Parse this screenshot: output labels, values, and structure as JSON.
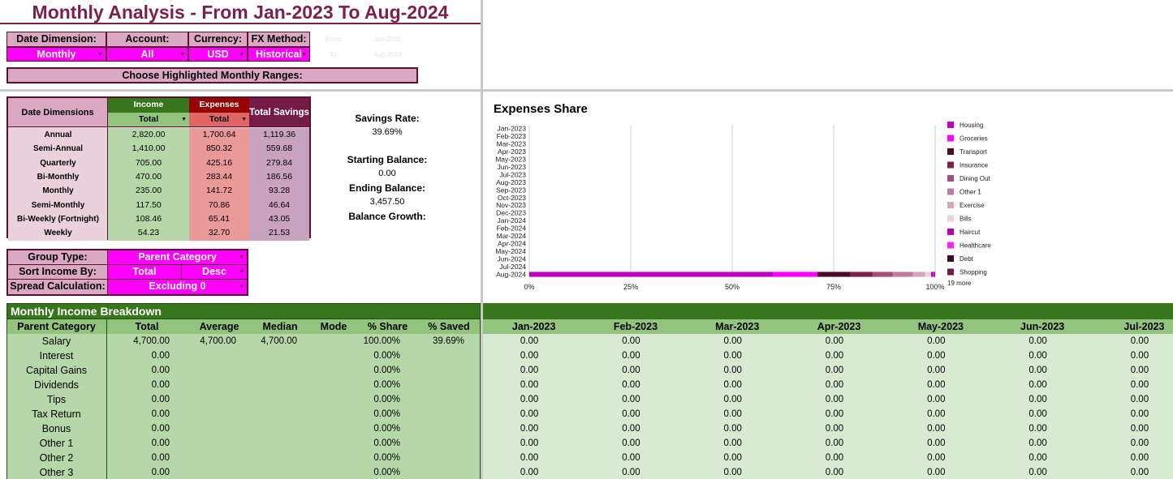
{
  "title": "Monthly Analysis - From Jan-2023 To Aug-2024",
  "controls": {
    "date_dimension": {
      "label": "Date Dimension:",
      "value": "Monthly"
    },
    "account": {
      "label": "Account:",
      "value": "All"
    },
    "currency": {
      "label": "Currency:",
      "value": "USD"
    },
    "fx_method": {
      "label": "FX Method:",
      "value": "Historical"
    },
    "from_label": "From:",
    "from_value": "Jan-2023",
    "to_label": "To:",
    "to_value": "Aug-2024",
    "highlight_ranges": "Choose Highlighted Monthly Ranges:"
  },
  "summary": {
    "date_dimensions_header": "Date Dimensions",
    "income_header": "Income",
    "expenses_header": "Expenses",
    "total_savings_header": "Total Savings",
    "income_sub": "Total",
    "expenses_sub": "Total",
    "rows": [
      {
        "label": "Annual",
        "income": "2,820.00",
        "expenses": "1,700.64",
        "savings": "1,119.36"
      },
      {
        "label": "Semi-Annual",
        "income": "1,410.00",
        "expenses": "850.32",
        "savings": "559.68"
      },
      {
        "label": "Quarterly",
        "income": "705.00",
        "expenses": "425.16",
        "savings": "279.84"
      },
      {
        "label": "Bi-Monthly",
        "income": "470.00",
        "expenses": "283.44",
        "savings": "186.56"
      },
      {
        "label": "Monthly",
        "income": "235.00",
        "expenses": "141.72",
        "savings": "93.28"
      },
      {
        "label": "Semi-Monthly",
        "income": "117.50",
        "expenses": "70.86",
        "savings": "46.64"
      },
      {
        "label": "Bi-Weekly (Fortnight)",
        "income": "108.46",
        "expenses": "65.41",
        "savings": "43.05"
      },
      {
        "label": "Weekly",
        "income": "54.23",
        "expenses": "32.70",
        "savings": "21.53"
      }
    ]
  },
  "stats": {
    "savings_rate_label": "Savings Rate:",
    "savings_rate_value": "39.69%",
    "starting_balance_label": "Starting Balance:",
    "starting_balance_value": "0.00",
    "ending_balance_label": "Ending Balance:",
    "ending_balance_value": "3,457.50",
    "balance_growth_label": "Balance Growth:"
  },
  "options": {
    "group_type_label": "Group Type:",
    "group_type_value": "Parent Category",
    "sort_income_label": "Sort Income By:",
    "sort_income_value": "Total",
    "sort_order_value": "Desc",
    "spread_label": "Spread Calculation:",
    "spread_value": "Excluding 0"
  },
  "breakdown": {
    "title": "Monthly Income Breakdown",
    "columns": [
      "Parent Category",
      "Total",
      "Average",
      "Median",
      "Mode",
      "% Share",
      "% Saved"
    ],
    "month_columns": [
      "Jan-2023",
      "Feb-2023",
      "Mar-2023",
      "Apr-2023",
      "May-2023",
      "Jun-2023",
      "Jul-2023"
    ],
    "rows": [
      {
        "category": "Salary",
        "total": "4,700.00",
        "average": "4,700.00",
        "median": "4,700.00",
        "mode": "",
        "share": "100.00%",
        "saved": "39.69%",
        "months": [
          "0.00",
          "0.00",
          "0.00",
          "0.00",
          "0.00",
          "0.00",
          "0.00"
        ]
      },
      {
        "category": "Interest",
        "total": "0.00",
        "average": "",
        "median": "",
        "mode": "",
        "share": "0.00%",
        "saved": "",
        "months": [
          "0.00",
          "0.00",
          "0.00",
          "0.00",
          "0.00",
          "0.00",
          "0.00"
        ]
      },
      {
        "category": "Capital Gains",
        "total": "0.00",
        "average": "",
        "median": "",
        "mode": "",
        "share": "0.00%",
        "saved": "",
        "months": [
          "0.00",
          "0.00",
          "0.00",
          "0.00",
          "0.00",
          "0.00",
          "0.00"
        ]
      },
      {
        "category": "Dividends",
        "total": "0.00",
        "average": "",
        "median": "",
        "mode": "",
        "share": "0.00%",
        "saved": "",
        "months": [
          "0.00",
          "0.00",
          "0.00",
          "0.00",
          "0.00",
          "0.00",
          "0.00"
        ]
      },
      {
        "category": "Tips",
        "total": "0.00",
        "average": "",
        "median": "",
        "mode": "",
        "share": "0.00%",
        "saved": "",
        "months": [
          "0.00",
          "0.00",
          "0.00",
          "0.00",
          "0.00",
          "0.00",
          "0.00"
        ]
      },
      {
        "category": "Tax Return",
        "total": "0.00",
        "average": "",
        "median": "",
        "mode": "",
        "share": "0.00%",
        "saved": "",
        "months": [
          "0.00",
          "0.00",
          "0.00",
          "0.00",
          "0.00",
          "0.00",
          "0.00"
        ]
      },
      {
        "category": "Bonus",
        "total": "0.00",
        "average": "",
        "median": "",
        "mode": "",
        "share": "0.00%",
        "saved": "",
        "months": [
          "0.00",
          "0.00",
          "0.00",
          "0.00",
          "0.00",
          "0.00",
          "0.00"
        ]
      },
      {
        "category": "Other 1",
        "total": "0.00",
        "average": "",
        "median": "",
        "mode": "",
        "share": "0.00%",
        "saved": "",
        "months": [
          "0.00",
          "0.00",
          "0.00",
          "0.00",
          "0.00",
          "0.00",
          "0.00"
        ]
      },
      {
        "category": "Other 2",
        "total": "0.00",
        "average": "",
        "median": "",
        "mode": "",
        "share": "0.00%",
        "saved": "",
        "months": [
          "0.00",
          "0.00",
          "0.00",
          "0.00",
          "0.00",
          "0.00",
          "0.00"
        ]
      },
      {
        "category": "Other 3",
        "total": "0.00",
        "average": "",
        "median": "",
        "mode": "",
        "share": "0.00%",
        "saved": "",
        "months": [
          "0.00",
          "0.00",
          "0.00",
          "0.00",
          "0.00",
          "0.00",
          "0.00"
        ]
      }
    ]
  },
  "chart_data": {
    "type": "bar",
    "orientation": "horizontal-stacked-100",
    "title": "Expenses Share",
    "categories": [
      "Jan-2023",
      "Feb-2023",
      "Mar-2023",
      "Apr-2023",
      "May-2023",
      "Jun-2023",
      "Jul-2023",
      "Aug-2023",
      "Sep-2023",
      "Oct-2023",
      "Nov-2023",
      "Dec-2023",
      "Jan-2024",
      "Feb-2024",
      "Mar-2024",
      "Apr-2024",
      "May-2024",
      "Jun-2024",
      "Jul-2024",
      "Aug-2024"
    ],
    "x_ticks": [
      "0%",
      "25%",
      "50%",
      "75%",
      "100%"
    ],
    "xlim": [
      0,
      100
    ],
    "grid": true,
    "legend_position": "right",
    "legend_more": "19 more",
    "series": [
      {
        "name": "Housing",
        "color": "#c000c0",
        "values": [
          0,
          0,
          0,
          0,
          0,
          0,
          0,
          0,
          0,
          0,
          0,
          0,
          0,
          0,
          0,
          0,
          0,
          0,
          0,
          60
        ]
      },
      {
        "name": "Groceries",
        "color": "#ff00ff",
        "values": [
          0,
          0,
          0,
          0,
          0,
          0,
          0,
          0,
          0,
          0,
          0,
          0,
          0,
          0,
          0,
          0,
          0,
          0,
          0,
          11
        ]
      },
      {
        "name": "Transport",
        "color": "#4a0a2a",
        "values": [
          0,
          0,
          0,
          0,
          0,
          0,
          0,
          0,
          0,
          0,
          0,
          0,
          0,
          0,
          0,
          0,
          0,
          0,
          0,
          8
        ]
      },
      {
        "name": "Insurance",
        "color": "#7b1f4b",
        "values": [
          0,
          0,
          0,
          0,
          0,
          0,
          0,
          0,
          0,
          0,
          0,
          0,
          0,
          0,
          0,
          0,
          0,
          0,
          0,
          5.5
        ]
      },
      {
        "name": "Dining Out",
        "color": "#a64d79",
        "values": [
          0,
          0,
          0,
          0,
          0,
          0,
          0,
          0,
          0,
          0,
          0,
          0,
          0,
          0,
          0,
          0,
          0,
          0,
          0,
          5
        ]
      },
      {
        "name": "Other 1",
        "color": "#c27ba0",
        "values": [
          0,
          0,
          0,
          0,
          0,
          0,
          0,
          0,
          0,
          0,
          0,
          0,
          0,
          0,
          0,
          0,
          0,
          0,
          0,
          5
        ]
      },
      {
        "name": "Exercise",
        "color": "#d5a6bd",
        "values": [
          0,
          0,
          0,
          0,
          0,
          0,
          0,
          0,
          0,
          0,
          0,
          0,
          0,
          0,
          0,
          0,
          0,
          0,
          0,
          3
        ]
      },
      {
        "name": "Bills",
        "color": "#ead1dc",
        "values": [
          0,
          0,
          0,
          0,
          0,
          0,
          0,
          0,
          0,
          0,
          0,
          0,
          0,
          0,
          0,
          0,
          0,
          0,
          0,
          1.5
        ]
      },
      {
        "name": "Haircut",
        "color": "#b000b0",
        "values": [
          0,
          0,
          0,
          0,
          0,
          0,
          0,
          0,
          0,
          0,
          0,
          0,
          0,
          0,
          0,
          0,
          0,
          0,
          0,
          0.5
        ]
      },
      {
        "name": "Healthcare",
        "color": "#ff22ff",
        "values": [
          0,
          0,
          0,
          0,
          0,
          0,
          0,
          0,
          0,
          0,
          0,
          0,
          0,
          0,
          0,
          0,
          0,
          0,
          0,
          0.3
        ]
      },
      {
        "name": "Debt",
        "color": "#3d0a24",
        "values": [
          0,
          0,
          0,
          0,
          0,
          0,
          0,
          0,
          0,
          0,
          0,
          0,
          0,
          0,
          0,
          0,
          0,
          0,
          0,
          0.1
        ]
      },
      {
        "name": "Shopping",
        "color": "#6e1a42",
        "values": [
          0,
          0,
          0,
          0,
          0,
          0,
          0,
          0,
          0,
          0,
          0,
          0,
          0,
          0,
          0,
          0,
          0,
          0,
          0,
          0.1
        ]
      }
    ]
  }
}
